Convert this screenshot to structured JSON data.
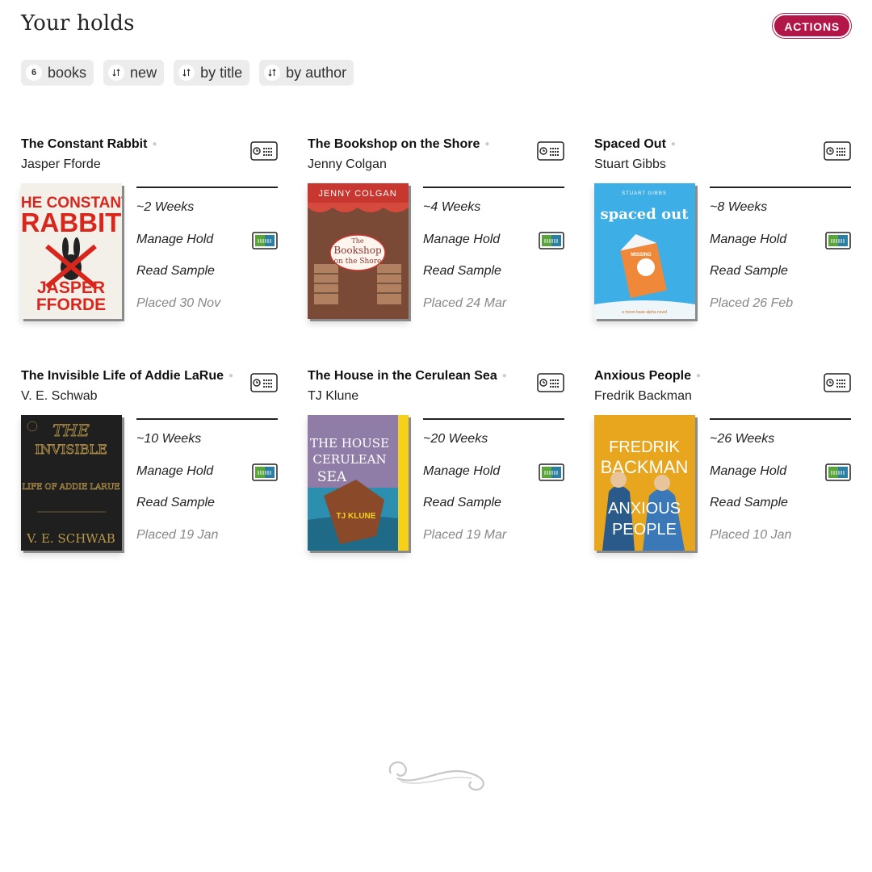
{
  "header": {
    "title": "Your holds",
    "actions_label": "ACTIONS",
    "accent_color": "#b3174a"
  },
  "filters": [
    {
      "count": "6",
      "label": "books"
    },
    {
      "icon": "sort-icon",
      "label": "new"
    },
    {
      "icon": "sort-icon",
      "label": "by title"
    },
    {
      "icon": "sort-icon",
      "label": "by author"
    }
  ],
  "holds": [
    {
      "title": "The Constant Rabbit",
      "author": "Jasper Fforde",
      "wait": "~2 Weeks",
      "manage": "Manage Hold",
      "sample": "Read Sample",
      "placed": "Placed 30 Nov",
      "cover": {
        "bg": "#f3f0ea",
        "text_color": "#d9261c",
        "line1": "THE CONSTANT",
        "line2": "RABBIT",
        "line3": "JASPER",
        "line4": "FFORDE"
      }
    },
    {
      "title": "The Bookshop on the Shore",
      "author": "Jenny Colgan",
      "wait": "~4 Weeks",
      "manage": "Manage Hold",
      "sample": "Read Sample",
      "placed": "Placed 24 Mar",
      "cover": {
        "bg": "#c8372f",
        "text_color": "#ffffff",
        "line1": "JENNY COLGAN",
        "line2": "The",
        "line3": "Bookshop",
        "line4": "on the Shore"
      }
    },
    {
      "title": "Spaced Out",
      "author": "Stuart Gibbs",
      "wait": "~8 Weeks",
      "manage": "Manage Hold",
      "sample": "Read Sample",
      "placed": "Placed 26 Feb",
      "cover": {
        "bg": "#3daee6",
        "text_color": "#ffffff",
        "line1": "STUART GIBBS",
        "line2": "spaced out",
        "line3": "MISSING",
        "line4": "a moon base alpha novel"
      }
    },
    {
      "title": "The Invisible Life of Addie LaRue",
      "author": "V. E. Schwab",
      "wait": "~10 Weeks",
      "manage": "Manage Hold",
      "sample": "Read Sample",
      "placed": "Placed 19 Jan",
      "cover": {
        "bg": "#1f1f1f",
        "text_color": "#b8964a",
        "line1": "THE",
        "line2": "INVISIBLE",
        "line3": "LIFE OF ADDIE LARUE",
        "line4": "V. E. SCHWAB"
      }
    },
    {
      "title": "The House in the Cerulean Sea",
      "author": "TJ Klune",
      "wait": "~20 Weeks",
      "manage": "Manage Hold",
      "sample": "Read Sample",
      "placed": "Placed 19 Mar",
      "cover": {
        "bg": "#2c8fb0",
        "text_color": "#ffffff",
        "line1": "THE HOUSE",
        "line2": "CERULEAN",
        "line3": "SEA",
        "line4": "TJ KLUNE"
      }
    },
    {
      "title": "Anxious People",
      "author": "Fredrik Backman",
      "wait": "~26 Weeks",
      "manage": "Manage Hold",
      "sample": "Read Sample",
      "placed": "Placed 10 Jan",
      "cover": {
        "bg": "#e8a51e",
        "text_color": "#ffffff",
        "line1": "FREDRIK",
        "line2": "BACKMAN",
        "line3": "ANXIOUS",
        "line4": "PEOPLE"
      }
    }
  ]
}
